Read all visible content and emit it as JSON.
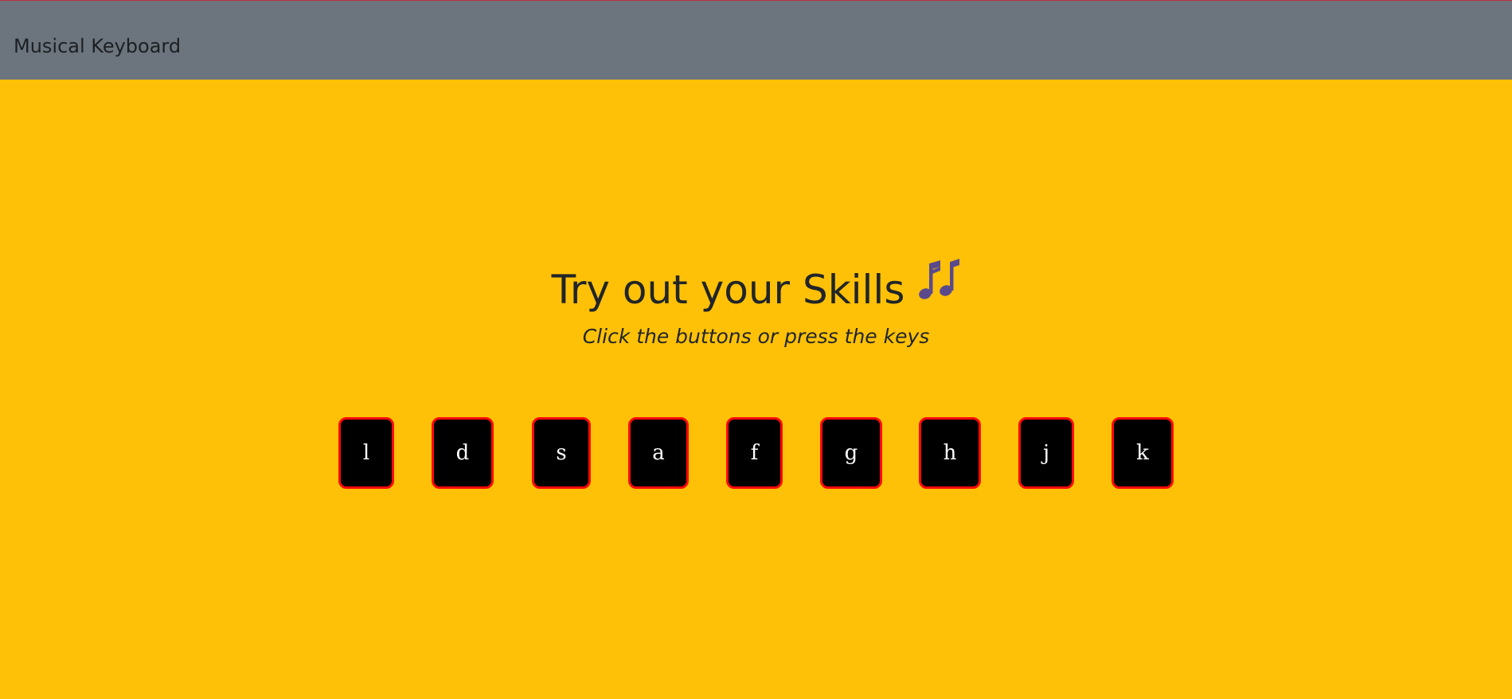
{
  "navbar": {
    "brand": "Musical Keyboard"
  },
  "hero": {
    "title": "Try out your Skills",
    "title_icon": "musical-notes-icon",
    "subtitle": "Click the buttons or press the keys"
  },
  "keys": [
    {
      "label": "l"
    },
    {
      "label": "d"
    },
    {
      "label": "s"
    },
    {
      "label": "a"
    },
    {
      "label": "f"
    },
    {
      "label": "g"
    },
    {
      "label": "h"
    },
    {
      "label": "j"
    },
    {
      "label": "k"
    }
  ],
  "colors": {
    "background": "#ffc107",
    "navbar": "#6c757d",
    "key_fill": "#000000",
    "key_border": "#ff0a0a",
    "icon": "#5a4a8c"
  }
}
